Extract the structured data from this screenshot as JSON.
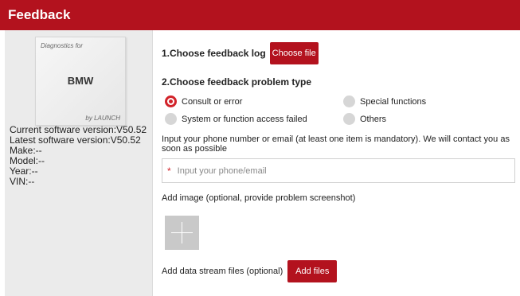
{
  "header": {
    "title": "Feedback"
  },
  "vehicle_card": {
    "top_text": "Diagnostics for",
    "brand": "BMW",
    "bottom_text": "by LAUNCH"
  },
  "vehicle_info": {
    "current_version": "Current software version:V50.52",
    "latest_version": "Latest software version:V50.52",
    "make": "Make:--",
    "model": "Model:--",
    "year": "Year:--",
    "vin": "VIN:--"
  },
  "feedback": {
    "step1_label": "1.Choose feedback log",
    "choose_file_button": "Choose file",
    "step2_label": "2.Choose feedback problem type",
    "problem_types": [
      {
        "label": "Consult or error",
        "selected": true
      },
      {
        "label": "Special functions",
        "selected": false
      },
      {
        "label": "System or function access failed",
        "selected": false
      },
      {
        "label": "Others",
        "selected": false
      }
    ],
    "contact_instruction": "Input your phone number or email (at least one item is mandatory). We will contact you as soon as possible",
    "contact_required_mark": "*",
    "contact_placeholder": "Input your phone/email",
    "contact_value": "",
    "image_label": "Add image (optional, provide problem screenshot)",
    "data_stream_label": "Add data stream files (optional)",
    "add_files_button": "Add files"
  },
  "colors": {
    "accent": "#b3121e",
    "radio_selected": "#d2232a",
    "panel_bg": "#ebebeb"
  }
}
